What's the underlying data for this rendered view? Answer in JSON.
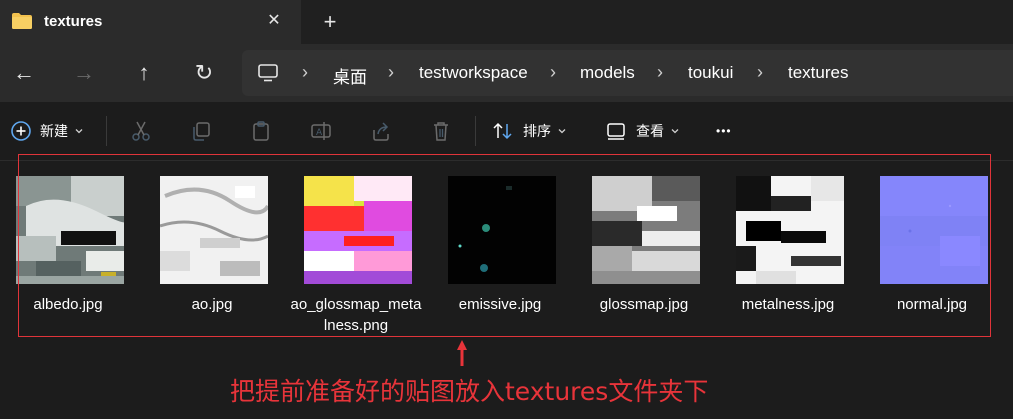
{
  "window": {
    "tab_title": "textures",
    "close_symbol": "✕",
    "new_tab_symbol": "+"
  },
  "navigation": {
    "back_symbol": "←",
    "forward_symbol": "→",
    "up_symbol": "↑",
    "refresh_symbol": "↻",
    "breadcrumb": [
      "桌面",
      "testworkspace",
      "models",
      "toukui",
      "textures"
    ],
    "separator": "›"
  },
  "toolbar": {
    "new_label": "新建",
    "sort_label": "排序",
    "view_label": "查看",
    "more_symbol": "•••",
    "icons": [
      "cut-icon",
      "copy-icon",
      "paste-icon",
      "rename-icon",
      "share-icon",
      "delete-icon"
    ]
  },
  "files": [
    {
      "name": "albedo.jpg",
      "thumb": "albedo"
    },
    {
      "name": "ao.jpg",
      "thumb": "ao"
    },
    {
      "name": "ao_glossmap_metalness.png",
      "thumb": "aogm"
    },
    {
      "name": "emissive.jpg",
      "thumb": "emissive"
    },
    {
      "name": "glossmap.jpg",
      "thumb": "gloss"
    },
    {
      "name": "metalness.jpg",
      "thumb": "metal"
    },
    {
      "name": "normal.jpg",
      "thumb": "normal"
    }
  ],
  "annotation": {
    "text": "把提前准备好的贴图放入textures文件夹下",
    "color": "#e8343a"
  },
  "colors": {
    "folder": "#f2c14e",
    "accent_blue": "#60a8f0",
    "normal_map": "#8080ff"
  }
}
